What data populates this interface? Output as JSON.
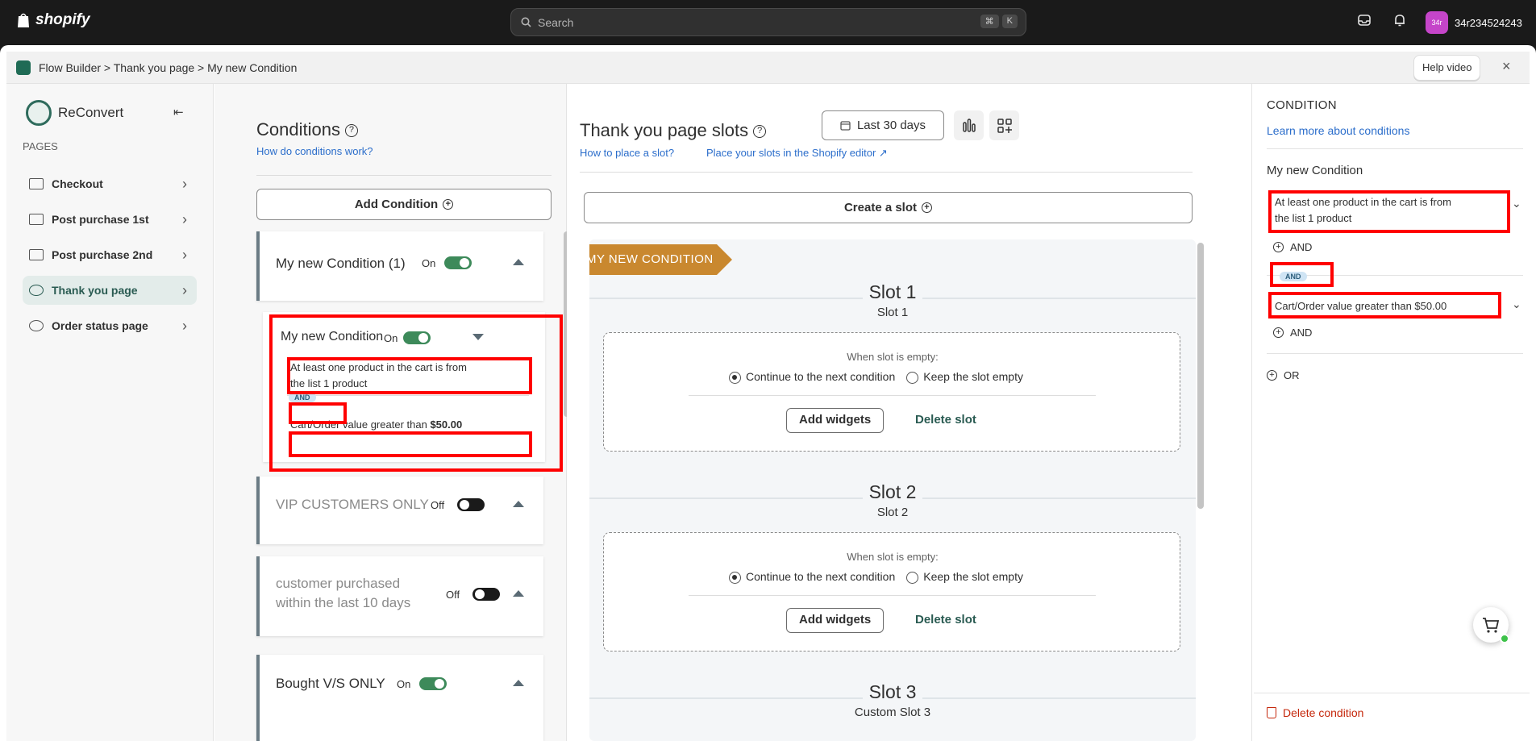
{
  "topbar": {
    "logo": "shopify",
    "search_placeholder": "Search",
    "kbd1": "⌘",
    "kbd2": "K",
    "avatar": "34r",
    "username": "34r234524243"
  },
  "app": {
    "breadcrumb": "Flow Builder > Thank you page > My new Condition",
    "help_button": "Help video",
    "close_icon": "×"
  },
  "sidebar": {
    "brand": "ReConvert",
    "pages_heading": "PAGES",
    "items": [
      {
        "label": "Checkout"
      },
      {
        "label": "Post purchase 1st"
      },
      {
        "label": "Post purchase 2nd"
      },
      {
        "label": "Thank you page"
      },
      {
        "label": "Order status page"
      }
    ]
  },
  "conditions": {
    "title": "Conditions",
    "help_link": "How do conditions work?",
    "add_button": "Add Condition",
    "cards": [
      {
        "name": "My new Condition (1)",
        "state": "On",
        "enabled": true
      },
      {
        "name": "VIP CUSTOMERS ONLY",
        "state": "Off",
        "enabled": false
      },
      {
        "name_line1": "customer purchased",
        "name_line2": "within the last 10 days",
        "state": "Off",
        "enabled": false
      },
      {
        "name": "Bought V/S ONLY",
        "state": "On",
        "enabled": true
      }
    ],
    "expanded": {
      "name": "My new Condition",
      "state": "On",
      "rule1_line1": "At least one product in the cart is from",
      "rule1_line2": "the list 1 product",
      "and": "AND",
      "rule2_prefix": "Cart/Order value greater than",
      "rule2_value": "$50.00"
    }
  },
  "slots": {
    "title": "Thank you page slots",
    "link1": "How to place a slot?",
    "link2": "Place your slots in the Shopify editor",
    "range": "Last 30 days",
    "create_button": "Create a slot",
    "ribbon": "MY NEW CONDITION",
    "empty_label": "When slot is empty:",
    "opt_continue": "Continue to the next condition",
    "opt_keep": "Keep the slot empty",
    "add_widgets": "Add widgets",
    "delete_slot": "Delete slot",
    "items": [
      {
        "title": "Slot 1",
        "subtitle": "Slot 1"
      },
      {
        "title": "Slot 2",
        "subtitle": "Slot 2"
      },
      {
        "title": "Slot 3",
        "subtitle": "Custom Slot 3"
      }
    ]
  },
  "panel": {
    "heading": "CONDITION",
    "learn_link": "Learn more about conditions",
    "name": "My new Condition",
    "rule1_line1": "At least one product in the cart is from",
    "rule1_line2": "the list 1 product",
    "and_label": "AND",
    "and_pill": "AND",
    "rule2": "Cart/Order value greater than $50.00",
    "or_label": "OR",
    "delete": "Delete condition"
  },
  "colors": {
    "accent": "#2a5b52",
    "toggle_on": "#3d8a5a",
    "ribbon": "#c9882f",
    "highlight": "#ff0000",
    "link": "#2c6ecb",
    "danger": "#c5280c"
  }
}
